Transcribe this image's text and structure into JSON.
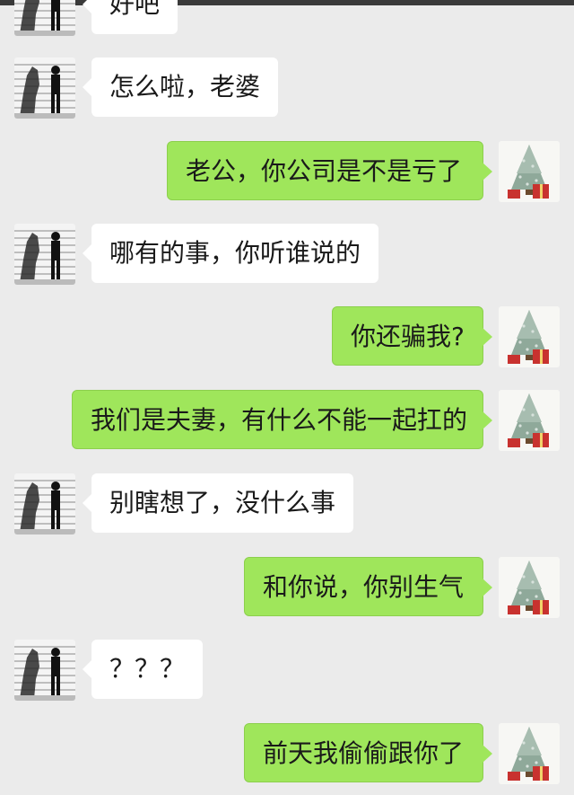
{
  "colors": {
    "background": "#ebebeb",
    "outgoing_bubble": "#9fe65b",
    "incoming_bubble": "#ffffff"
  },
  "avatars": {
    "contact": "walking-man-photo-icon",
    "self": "christmas-tree-photo-icon"
  },
  "messages": [
    {
      "side": "in",
      "text": "好吧"
    },
    {
      "side": "in",
      "text": "怎么啦，老婆"
    },
    {
      "side": "out",
      "text": "老公，你公司是不是亏了"
    },
    {
      "side": "in",
      "text": "哪有的事，你听谁说的"
    },
    {
      "side": "out",
      "text": "你还骗我?"
    },
    {
      "side": "out",
      "text": "我们是夫妻，有什么不能一起扛的"
    },
    {
      "side": "in",
      "text": "别瞎想了，没什么事"
    },
    {
      "side": "out",
      "text": "和你说，你别生气"
    },
    {
      "side": "in",
      "text": "？？？"
    },
    {
      "side": "out",
      "text": "前天我偷偷跟你了"
    }
  ]
}
